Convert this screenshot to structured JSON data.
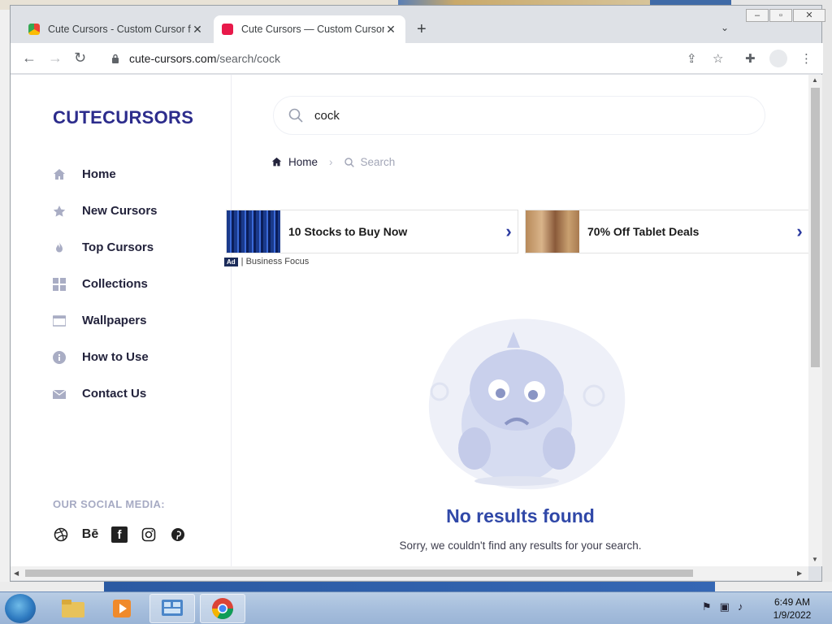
{
  "browser": {
    "tabs": [
      {
        "title": "Cute Cursors - Custom Cursor for Chrome",
        "active": false
      },
      {
        "title": "Cute Cursors — Custom Cursors",
        "active": true
      }
    ],
    "url_host": "cute-cursors.com",
    "url_path": "/search/cock"
  },
  "site": {
    "logo": "CUTECURSORS",
    "menu": [
      {
        "label": "Home",
        "icon": "home-icon"
      },
      {
        "label": "New Cursors",
        "icon": "star-icon"
      },
      {
        "label": "Top Cursors",
        "icon": "flame-icon"
      },
      {
        "label": "Collections",
        "icon": "grid-icon"
      },
      {
        "label": "Wallpapers",
        "icon": "wallpaper-icon"
      },
      {
        "label": "How to Use",
        "icon": "info-icon"
      },
      {
        "label": "Contact Us",
        "icon": "mail-icon"
      }
    ],
    "social_title": "OUR SOCIAL MEDIA:",
    "social": [
      "dribbble-icon",
      "behance-icon",
      "facebook-icon",
      "instagram-icon",
      "pinterest-icon"
    ],
    "behance_text": "Bē",
    "facebook_text": "f"
  },
  "search": {
    "value": "cock"
  },
  "breadcrumb": {
    "home": "Home",
    "current": "Search"
  },
  "ads": {
    "items": [
      {
        "text": "10 Stocks to Buy Now"
      },
      {
        "text": "70% Off Tablet Deals"
      }
    ],
    "badge": "Ad",
    "source": "| Business Focus"
  },
  "empty": {
    "title": "No results found",
    "subtitle": "Sorry, we couldn't find any results for your search."
  },
  "taskbar": {
    "time": "6:49 AM",
    "date": "1/9/2022"
  },
  "colors": {
    "brand": "#2c2c8c",
    "accent": "#3048a8"
  }
}
